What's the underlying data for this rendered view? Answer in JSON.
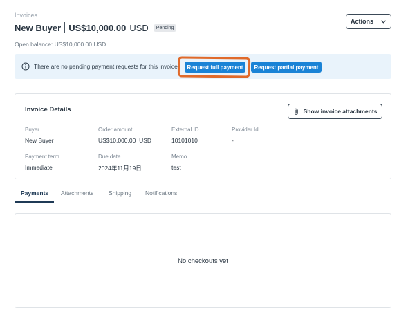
{
  "breadcrumb": "Invoices",
  "header": {
    "buyer": "New Buyer",
    "amount": "US$10,000.00",
    "currency": "USD",
    "status": "Pending",
    "actions_label": "Actions"
  },
  "open_balance": "Open balance: US$10,000.00 USD",
  "alert": {
    "text": "There are no pending payment requests for this invoice",
    "request_full": "Request full payment",
    "request_partial": "Request partial payment"
  },
  "invoice_details": {
    "title": "Invoice Details",
    "attachments_button": "Show invoice attachments",
    "fields": [
      {
        "label": "Buyer",
        "value": "New Buyer"
      },
      {
        "label": "Order amount",
        "value": "US$10,000.00  USD"
      },
      {
        "label": "External ID",
        "value": "10101010"
      },
      {
        "label": "Provider Id",
        "value": "-"
      },
      {
        "label": "Payment term",
        "value": "Immediate"
      },
      {
        "label": "Due date",
        "value": "2024年11月19日"
      },
      {
        "label": "Memo",
        "value": "test"
      }
    ]
  },
  "tabs": [
    {
      "label": "Payments",
      "active": true
    },
    {
      "label": "Attachments"
    },
    {
      "label": "Shipping"
    },
    {
      "label": "Notifications"
    }
  ],
  "payments_panel": {
    "empty_message": "No checkouts yet"
  },
  "colors": {
    "primary": "#1a83d6",
    "alert_bg": "#e9f3fb",
    "highlight": "#e06a2b"
  }
}
